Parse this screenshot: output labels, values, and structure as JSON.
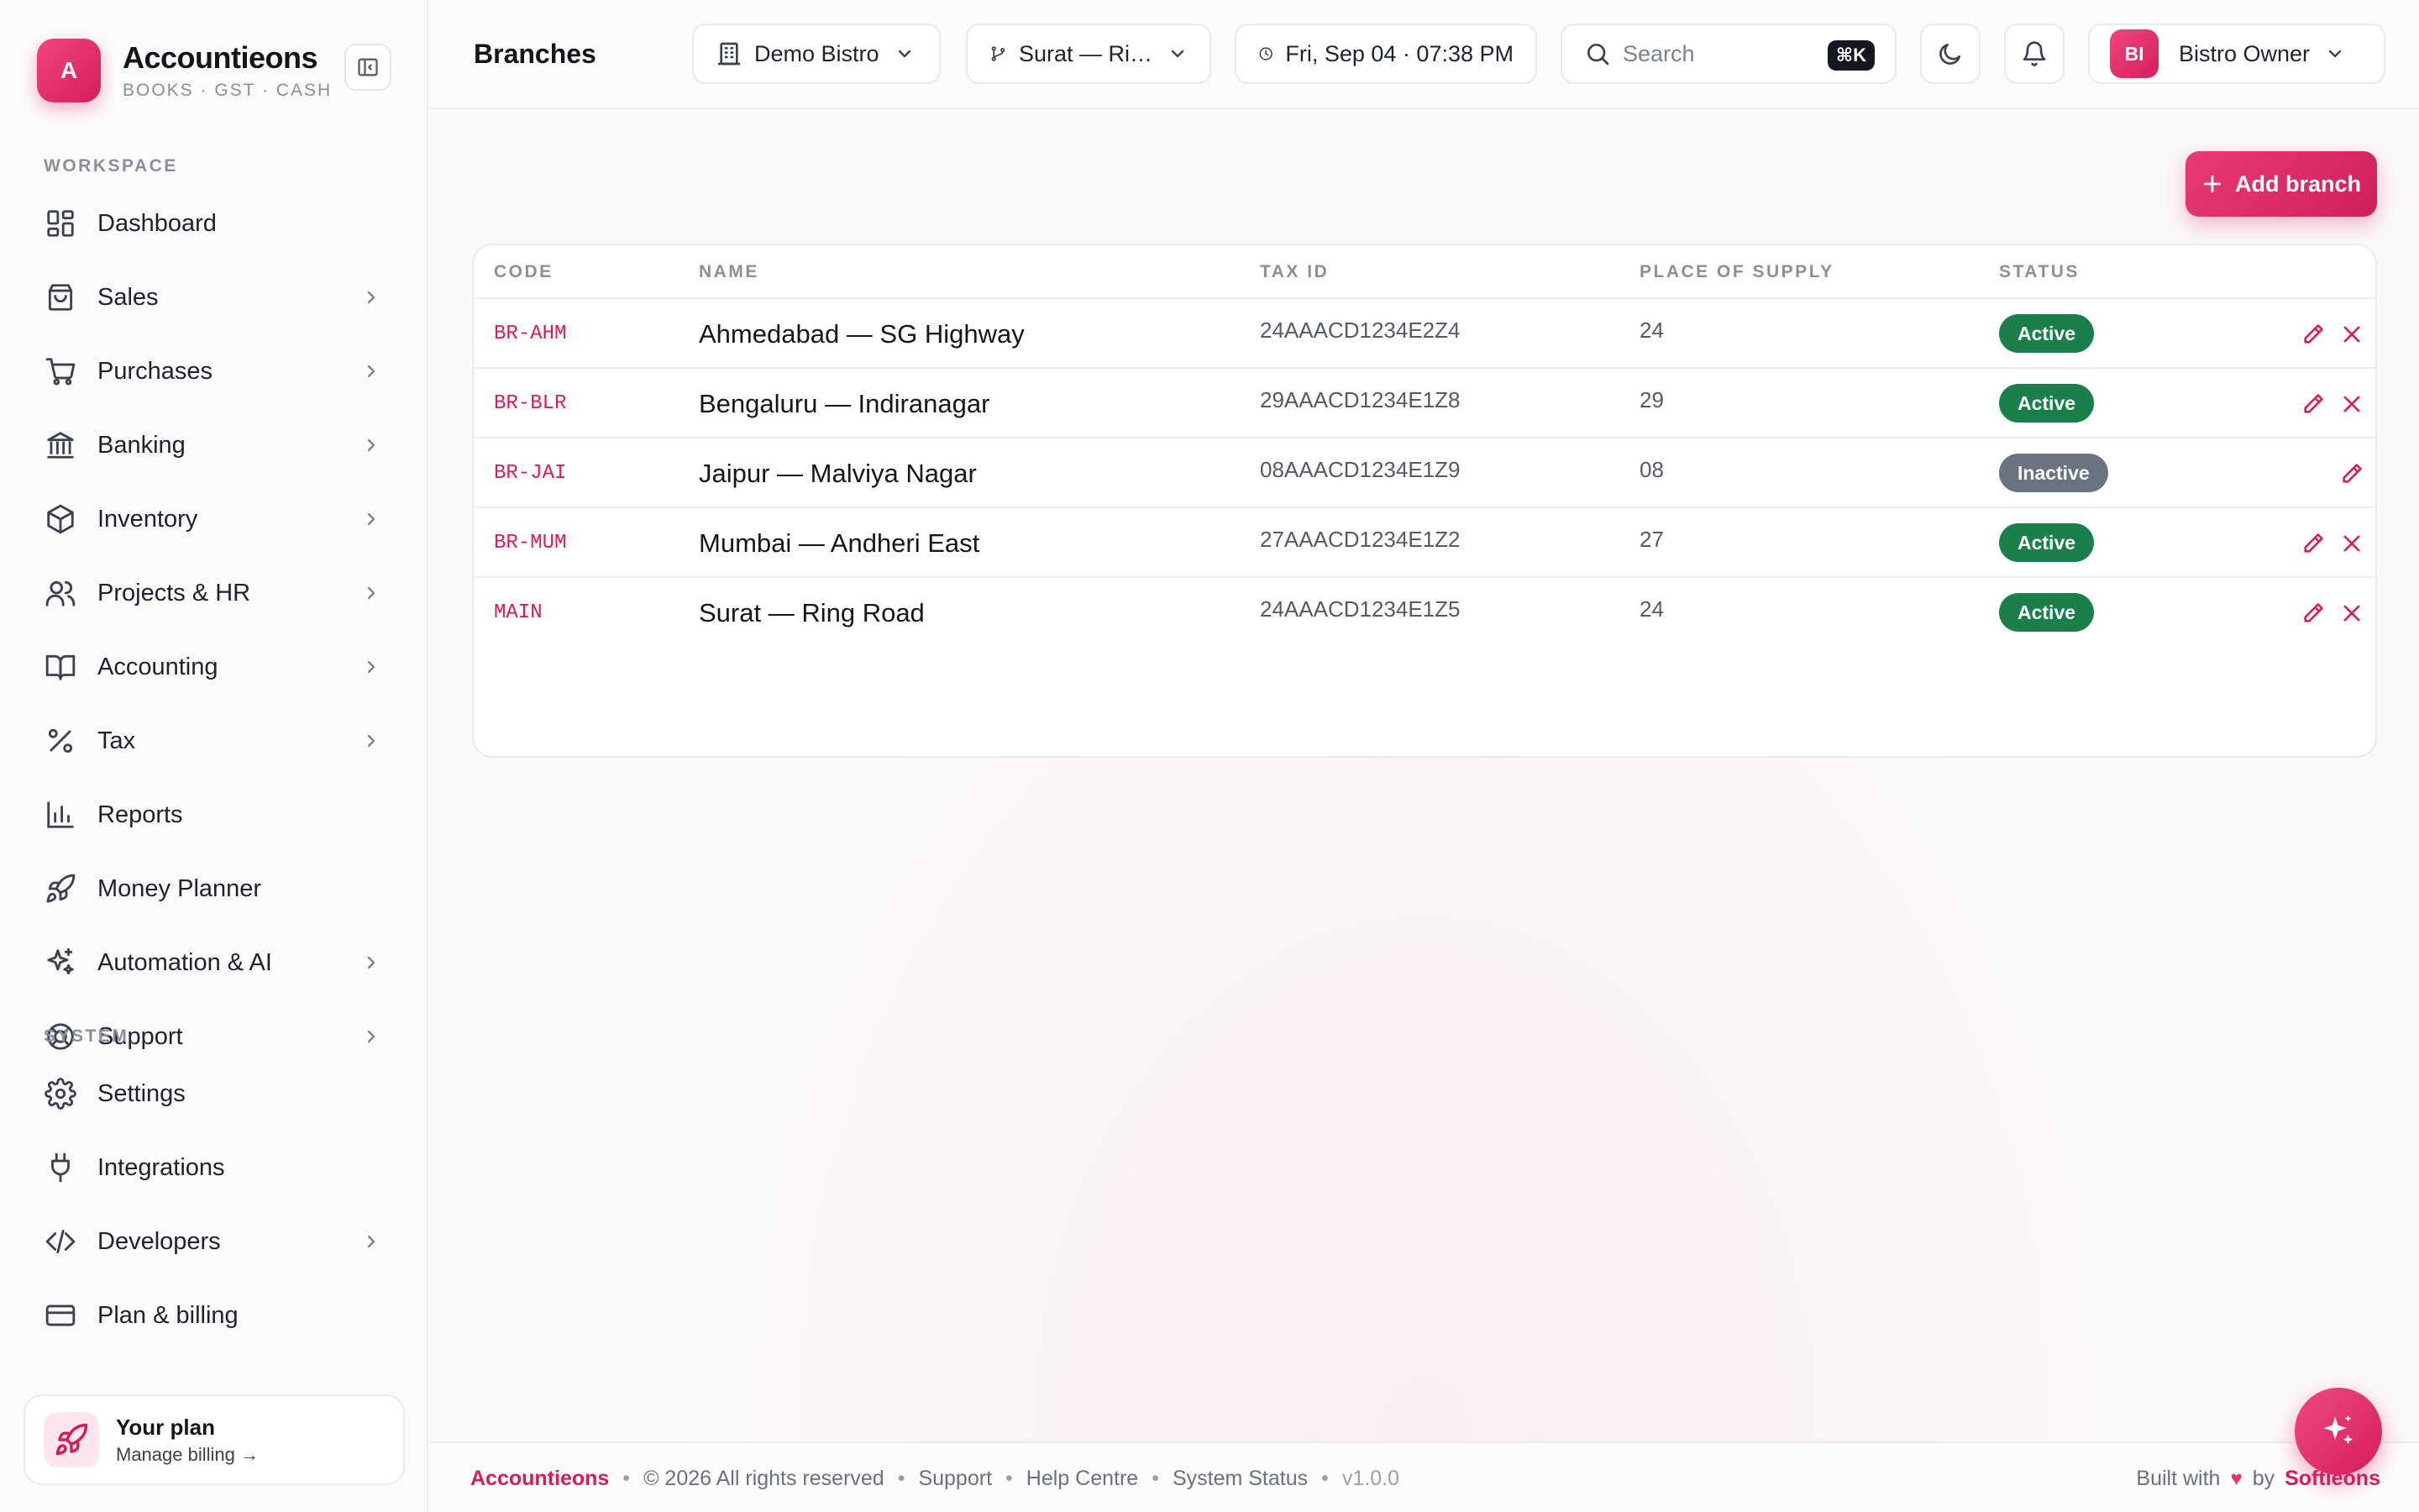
{
  "brand": {
    "logo_letter": "A",
    "name": "Accountieons",
    "tagline": "BOOKS · GST · CASH"
  },
  "sidebar": {
    "workspace_label": "WORKSPACE",
    "workspace_items": [
      {
        "label": "Dashboard",
        "icon": "dashboard-icon",
        "has_submenu": false
      },
      {
        "label": "Sales",
        "icon": "shopping-bag-icon",
        "has_submenu": true
      },
      {
        "label": "Purchases",
        "icon": "cart-icon",
        "has_submenu": true
      },
      {
        "label": "Banking",
        "icon": "bank-icon",
        "has_submenu": true
      },
      {
        "label": "Inventory",
        "icon": "package-icon",
        "has_submenu": true
      },
      {
        "label": "Projects & HR",
        "icon": "users-icon",
        "has_submenu": true
      },
      {
        "label": "Accounting",
        "icon": "book-icon",
        "has_submenu": true
      },
      {
        "label": "Tax",
        "icon": "percent-icon",
        "has_submenu": true
      },
      {
        "label": "Reports",
        "icon": "bar-chart-icon",
        "has_submenu": false
      },
      {
        "label": "Money Planner",
        "icon": "rocket-icon",
        "has_submenu": false
      },
      {
        "label": "Automation & AI",
        "icon": "sparkles-icon",
        "has_submenu": true
      },
      {
        "label": "Support",
        "icon": "lifebuoy-icon",
        "has_submenu": true
      }
    ],
    "system_label": "SYSTEM",
    "system_items": [
      {
        "label": "Settings",
        "icon": "gear-icon",
        "has_submenu": false
      },
      {
        "label": "Integrations",
        "icon": "plug-icon",
        "has_submenu": false
      },
      {
        "label": "Developers",
        "icon": "code-icon",
        "has_submenu": true
      },
      {
        "label": "Plan & billing",
        "icon": "credit-card-icon",
        "has_submenu": false
      }
    ],
    "plan_card": {
      "title": "Your plan",
      "subtitle": "Manage billing →"
    }
  },
  "header": {
    "page_title": "Branches",
    "company_selector": "Demo Bistro",
    "branch_selector": "Surat — Ri…",
    "datetime": "Fri, Sep 04 · 07:38 PM",
    "search_placeholder": "Search",
    "search_shortcut": "⌘K",
    "user": {
      "initials": "BI",
      "name": "Bistro Owner"
    }
  },
  "main": {
    "add_button_label": "Add branch",
    "table": {
      "columns": [
        "CODE",
        "NAME",
        "TAX ID",
        "PLACE OF SUPPLY",
        "STATUS"
      ],
      "rows": [
        {
          "code": "BR-AHM",
          "name": "Ahmedabad — SG Highway",
          "tax_id": "24AAACD1234E2Z4",
          "place_of_supply": "24",
          "status": "Active",
          "deletable": true
        },
        {
          "code": "BR-BLR",
          "name": "Bengaluru — Indiranagar",
          "tax_id": "29AAACD1234E1Z8",
          "place_of_supply": "29",
          "status": "Active",
          "deletable": true
        },
        {
          "code": "BR-JAI",
          "name": "Jaipur — Malviya Nagar",
          "tax_id": "08AAACD1234E1Z9",
          "place_of_supply": "08",
          "status": "Inactive",
          "deletable": false
        },
        {
          "code": "BR-MUM",
          "name": "Mumbai — Andheri East",
          "tax_id": "27AAACD1234E1Z2",
          "place_of_supply": "27",
          "status": "Active",
          "deletable": true
        },
        {
          "code": "MAIN",
          "name": "Surat — Ring Road",
          "tax_id": "24AAACD1234E1Z5",
          "place_of_supply": "24",
          "status": "Active",
          "deletable": true
        }
      ]
    }
  },
  "footer": {
    "brand": "Accountieons",
    "copyright": "© 2026 All rights reserved",
    "links": [
      "Support",
      "Help Centre",
      "System Status"
    ],
    "version": "v1.0.0",
    "built_with": "Built with",
    "by": "by",
    "maker": "Softieons"
  },
  "colors": {
    "accent": "#d61d5c",
    "active_badge": "#1a7f4b",
    "inactive_badge": "#6b7280"
  }
}
